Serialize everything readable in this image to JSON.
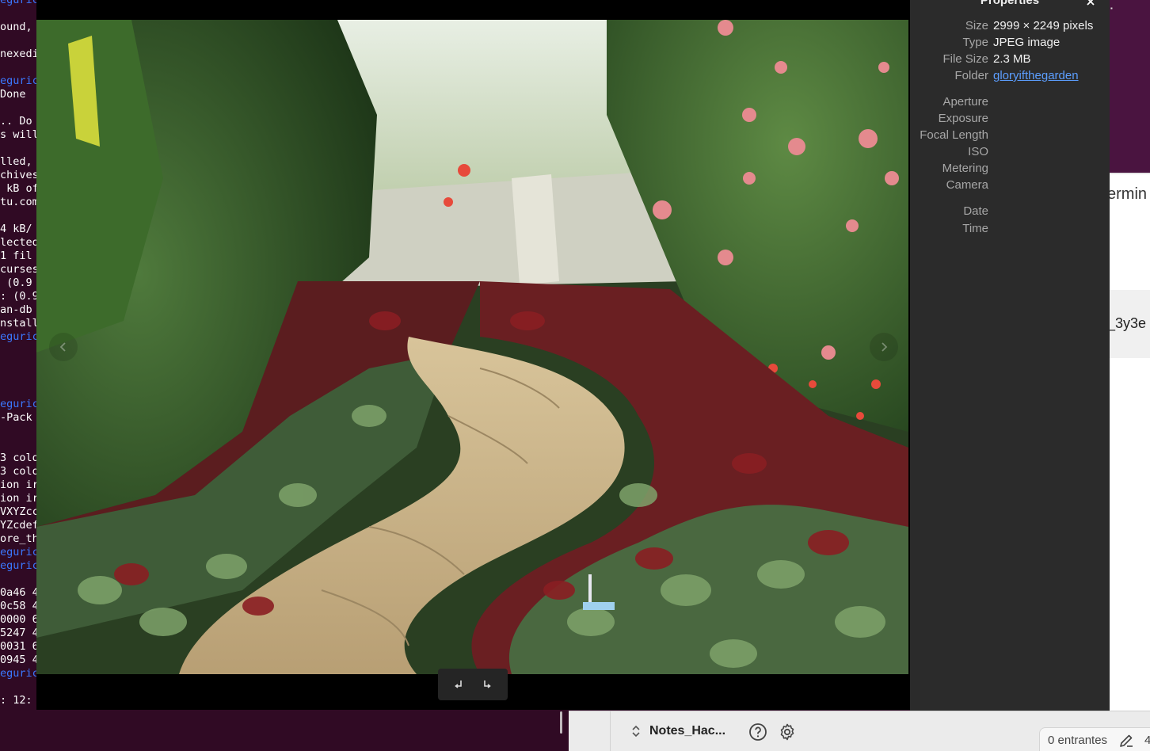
{
  "terminal": {
    "lines": [
      {
        "text": "eguric",
        "color": "blue"
      },
      {
        "text": "ound,",
        "color": "white"
      },
      {
        "text": "nexedi",
        "color": "white"
      },
      {
        "text": "eguric",
        "color": "blue"
      },
      {
        "text": "Done",
        "color": "white"
      },
      {
        "text": ".. Do",
        "color": "white"
      },
      {
        "text": "s will",
        "color": "white"
      },
      {
        "text": "lled,",
        "color": "white"
      },
      {
        "text": "chives",
        "color": "white"
      },
      {
        "text": " kB of",
        "color": "white"
      },
      {
        "text": "tu.com",
        "color": "white"
      },
      {
        "text": "4 kB/",
        "color": "white"
      },
      {
        "text": "lecteo",
        "color": "white"
      },
      {
        "text": "1 fil",
        "color": "white"
      },
      {
        "text": "curses",
        "color": "white"
      },
      {
        "text": " (0.9",
        "color": "white"
      },
      {
        "text": ": (0.9",
        "color": "white"
      },
      {
        "text": "an-db",
        "color": "white"
      },
      {
        "text": "nstall",
        "color": "white"
      },
      {
        "text": "eguric",
        "color": "blue"
      },
      {
        "text": "eguric",
        "color": "blue"
      },
      {
        "text": "-Pack",
        "color": "white"
      },
      {
        "text": "3 colo",
        "color": "white"
      },
      {
        "text": "3 colo",
        "color": "white"
      },
      {
        "text": "ion ir",
        "color": "white"
      },
      {
        "text": "ion ir",
        "color": "white"
      },
      {
        "text": "VXYZcc",
        "color": "white"
      },
      {
        "text": "YZcdef",
        "color": "white"
      },
      {
        "text": "ore_th",
        "color": "white"
      },
      {
        "text": "eguric",
        "color": "blue"
      },
      {
        "text": "eguric",
        "color": "blue"
      },
      {
        "text": "0a46 4",
        "color": "white"
      },
      {
        "text": "0c58 4",
        "color": "white"
      },
      {
        "text": "0000 6",
        "color": "white"
      },
      {
        "text": "5247 4",
        "color": "white"
      },
      {
        "text": "0031 6",
        "color": "white"
      },
      {
        "text": "0945 4",
        "color": "white"
      },
      {
        "text": "eguric",
        "color": "blue"
      },
      {
        "text": ": 12:",
        "color": "white"
      }
    ]
  },
  "properties": {
    "title": "Properties",
    "close_icon": "close-icon",
    "rows": [
      {
        "label": "Size",
        "value": "2999 × 2249 pixels",
        "link": false
      },
      {
        "label": "Type",
        "value": "JPEG image",
        "link": false
      },
      {
        "label": "File Size",
        "value": "2.3 MB",
        "link": false
      },
      {
        "label": "Folder",
        "value": "gloryifthegarden",
        "link": true
      },
      {
        "label": "Aperture",
        "value": "",
        "link": false
      },
      {
        "label": "Exposure",
        "value": "",
        "link": false
      },
      {
        "label": "Focal Length",
        "value": "",
        "link": false
      },
      {
        "label": "ISO",
        "value": "",
        "link": false
      },
      {
        "label": "Metering",
        "value": "",
        "link": false
      },
      {
        "label": "Camera",
        "value": "",
        "link": false
      },
      {
        "label": "Date",
        "value": "",
        "link": false
      },
      {
        "label": "Time",
        "value": "",
        "link": false
      }
    ]
  },
  "viewer": {
    "rotate_left_icon": "rotate-left-icon",
    "rotate_right_icon": "rotate-right-icon",
    "prev_icon": "chevron-left-icon",
    "next_icon": "chevron-right-icon"
  },
  "background_app": {
    "heading_fragment": "ermin",
    "id_fragment": "_3y3e",
    "vault_name": "Notes_Hac...",
    "status_text": "0 entrantes",
    "status_number": "4"
  }
}
